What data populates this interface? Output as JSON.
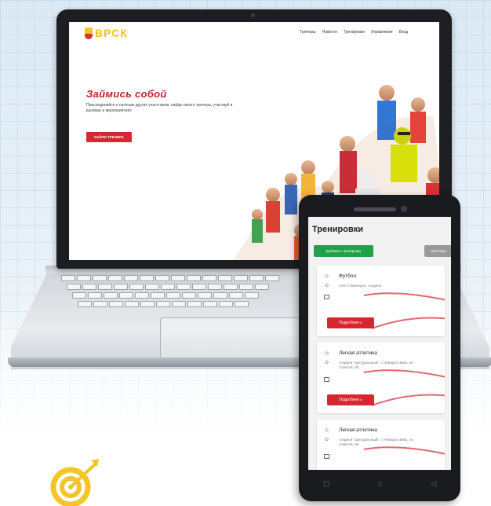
{
  "site": {
    "logo_text": "ВРСК",
    "nav": [
      "Тренеры",
      "Новости",
      "Тренировки",
      "Управление",
      "Вход"
    ],
    "hero_title": "Займись собой",
    "hero_subtitle": "Присоединяйся к тысячам других участников, найди своего тренера, участвуй в вызовах и мероприятиях",
    "hero_button": "НАЙТИ ТРЕНЕРА"
  },
  "app": {
    "title": "Тренировки",
    "add_button": "Добавить тренировку",
    "general_button": "Обычные",
    "cards": [
      {
        "title": "Футбол",
        "place": "село Семигорье, стадион",
        "more": "Подробнее ▹"
      },
      {
        "title": "Легкая атлетика",
        "place": "стадион \"Центральный\", г. Новороссийск, ул. Советов, 55",
        "more": "Подробнее ▹"
      },
      {
        "title": "Легкая атлетика",
        "place": "стадион \"Центральный\", г. Новороссийск, ул. Советов, 55",
        "more": ""
      }
    ],
    "nav_icons": [
      "square-icon",
      "home-icon",
      "back-icon"
    ]
  },
  "colors": {
    "accent_red": "#d72631",
    "green": "#1fa34a",
    "logo_yellow": "#f5c21b"
  }
}
